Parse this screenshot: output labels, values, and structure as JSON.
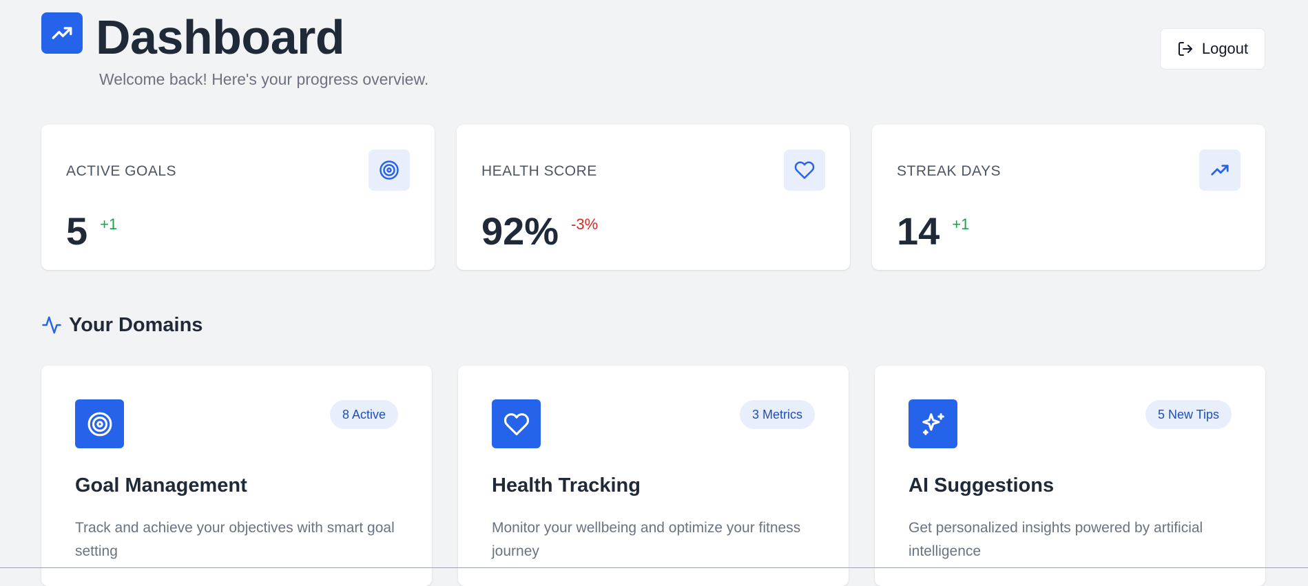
{
  "header": {
    "title": "Dashboard",
    "subtitle": "Welcome back! Here's your progress overview.",
    "logout_label": "Logout"
  },
  "stats": [
    {
      "label": "ACTIVE GOALS",
      "value": "5",
      "delta": "+1",
      "trend": "up",
      "icon": "target-icon"
    },
    {
      "label": "HEALTH SCORE",
      "value": "92%",
      "delta": "-3%",
      "trend": "down",
      "icon": "heart-icon"
    },
    {
      "label": "STREAK DAYS",
      "value": "14",
      "delta": "+1",
      "trend": "up",
      "icon": "trending-up-icon"
    }
  ],
  "domains_section": {
    "title": "Your Domains",
    "icon": "activity-icon"
  },
  "domains": [
    {
      "name": "Goal Management",
      "badge": "8 Active",
      "description": "Track and achieve your objectives with smart goal setting",
      "icon": "target-icon"
    },
    {
      "name": "Health Tracking",
      "badge": "3 Metrics",
      "description": "Monitor your wellbeing and optimize your fitness journey",
      "icon": "heart-icon"
    },
    {
      "name": "AI Suggestions",
      "badge": "5 New Tips",
      "description": "Get personalized insights powered by artificial intelligence",
      "icon": "sparkles-icon"
    }
  ],
  "colors": {
    "accent": "#2563eb",
    "background": "#f2f3f5",
    "positive": "#16a34a",
    "negative": "#dc2626"
  }
}
